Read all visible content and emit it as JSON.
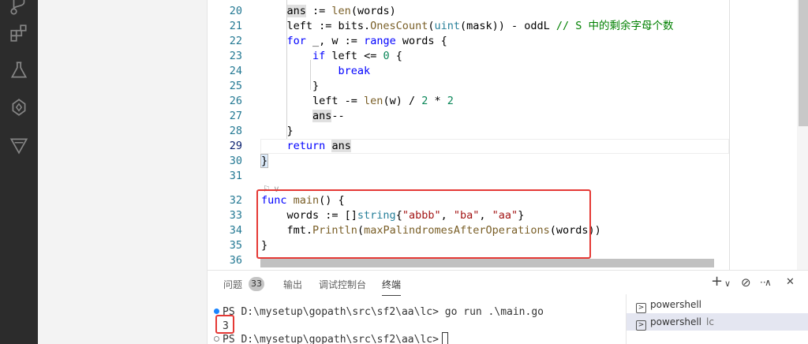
{
  "editor": {
    "lines": [
      {
        "no": "20",
        "segs": [
          {
            "t": "    "
          },
          {
            "t": "ans",
            "c": "hl"
          },
          {
            "t": " := "
          },
          {
            "t": "len",
            "c": "fn"
          },
          {
            "t": "(words)"
          }
        ]
      },
      {
        "no": "21",
        "segs": [
          {
            "t": "    left := bits."
          },
          {
            "t": "OnesCount",
            "c": "fn"
          },
          {
            "t": "("
          },
          {
            "t": "uint",
            "c": "ty"
          },
          {
            "t": "(mask)) - oddL "
          },
          {
            "t": "// S 中的剩余字母个数",
            "c": "cm"
          }
        ]
      },
      {
        "no": "22",
        "segs": [
          {
            "t": "    "
          },
          {
            "t": "for",
            "c": "kw"
          },
          {
            "t": " _, w := "
          },
          {
            "t": "range",
            "c": "kw"
          },
          {
            "t": " words {"
          }
        ]
      },
      {
        "no": "23",
        "segs": [
          {
            "t": "        "
          },
          {
            "t": "if",
            "c": "kw"
          },
          {
            "t": " left <= "
          },
          {
            "t": "0",
            "c": "num"
          },
          {
            "t": " {"
          }
        ]
      },
      {
        "no": "24",
        "segs": [
          {
            "t": "            "
          },
          {
            "t": "break",
            "c": "kw"
          }
        ]
      },
      {
        "no": "25",
        "segs": [
          {
            "t": "        }"
          }
        ]
      },
      {
        "no": "26",
        "segs": [
          {
            "t": "        left -= "
          },
          {
            "t": "len",
            "c": "fn"
          },
          {
            "t": "(w) / "
          },
          {
            "t": "2",
            "c": "num"
          },
          {
            "t": " * "
          },
          {
            "t": "2",
            "c": "num"
          }
        ]
      },
      {
        "no": "27",
        "segs": [
          {
            "t": "        "
          },
          {
            "t": "ans",
            "c": "hl"
          },
          {
            "t": "--"
          }
        ]
      },
      {
        "no": "28",
        "segs": [
          {
            "t": "    }"
          }
        ]
      },
      {
        "no": "29",
        "segs": [
          {
            "t": "    "
          },
          {
            "t": "return",
            "c": "kw"
          },
          {
            "t": " "
          },
          {
            "t": "ans",
            "c": "hl"
          }
        ]
      },
      {
        "no": "30",
        "segs": [
          {
            "t": "}",
            "c": "bracket-hl"
          }
        ]
      },
      {
        "no": "31",
        "segs": []
      },
      {
        "no": "32",
        "segs": [
          {
            "t": "func",
            "c": "kw"
          },
          {
            "t": " "
          },
          {
            "t": "main",
            "c": "fn"
          },
          {
            "t": "() {"
          }
        ]
      },
      {
        "no": "33",
        "segs": [
          {
            "t": "    words := []"
          },
          {
            "t": "string",
            "c": "ty"
          },
          {
            "t": "{"
          },
          {
            "t": "\"abbb\"",
            "c": "str"
          },
          {
            "t": ", "
          },
          {
            "t": "\"ba\"",
            "c": "str"
          },
          {
            "t": ", "
          },
          {
            "t": "\"aa\"",
            "c": "str"
          },
          {
            "t": "}"
          }
        ]
      },
      {
        "no": "34",
        "segs": [
          {
            "t": "    fmt."
          },
          {
            "t": "Println",
            "c": "fn"
          },
          {
            "t": "("
          },
          {
            "t": "maxPalindromesAfterOperations",
            "c": "fn"
          },
          {
            "t": "(words))"
          }
        ]
      },
      {
        "no": "35",
        "segs": [
          {
            "t": "}"
          }
        ]
      },
      {
        "no": "36",
        "segs": []
      }
    ],
    "codelens": "⚐ ∨"
  },
  "panel": {
    "tabs": [
      {
        "label": "问题"
      },
      {
        "label": "输出"
      },
      {
        "label": "调试控制台"
      },
      {
        "label": "终端"
      }
    ],
    "problems_count": "33",
    "actions": {
      "add": "+",
      "dropdown": "∨",
      "kill": "⊘",
      "more": "···",
      "maximize": "∧",
      "close": "✕"
    },
    "terminal_lines": {
      "cmd": "PS D:\\mysetup\\gopath\\src\\sf2\\aa\\lc> go run .\\main.go",
      "output": "3",
      "prompt": "PS D:\\mysetup\\gopath\\src\\sf2\\aa\\lc>"
    },
    "terminals": [
      {
        "name": "powershell",
        "sub": ""
      },
      {
        "name": "powershell",
        "sub": "lc"
      }
    ]
  },
  "colors": {
    "accent": "#1a85ff",
    "highlight_box": "#e53935"
  }
}
